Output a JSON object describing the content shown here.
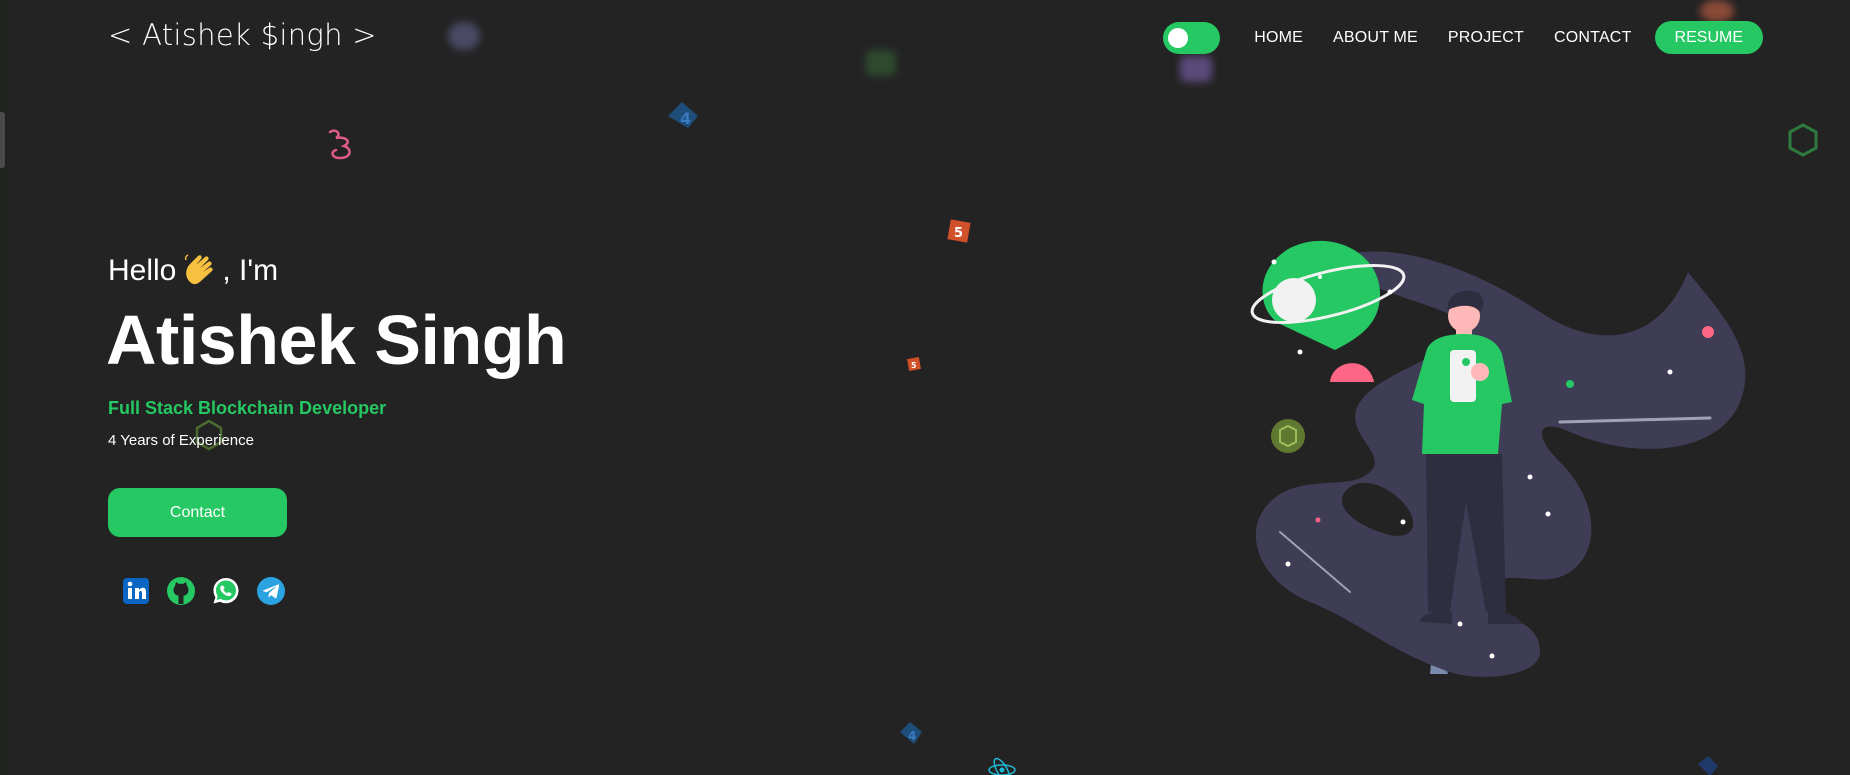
{
  "nav": {
    "logo": "< Atishek $ingh >",
    "links": [
      "HOME",
      "ABOUT ME",
      "PROJECT",
      "CONTACT"
    ],
    "resume_label": "RESUME",
    "theme_toggle": "on"
  },
  "hero": {
    "greeting_before": "Hello",
    "greeting_after": ", I'm",
    "name": "Atishek Singh",
    "role": "Full Stack Blockchain Developer",
    "experience": "4 Years of Experience",
    "contact_label": "Contact"
  },
  "socials": [
    {
      "icon": "linkedin-icon"
    },
    {
      "icon": "github-icon"
    },
    {
      "icon": "whatsapp-icon"
    },
    {
      "icon": "telegram-icon"
    }
  ],
  "colors": {
    "background": "#232323",
    "accent": "#25c862",
    "illustration_dark": "#3f3d56",
    "illustration_pink": "#ff6584"
  }
}
